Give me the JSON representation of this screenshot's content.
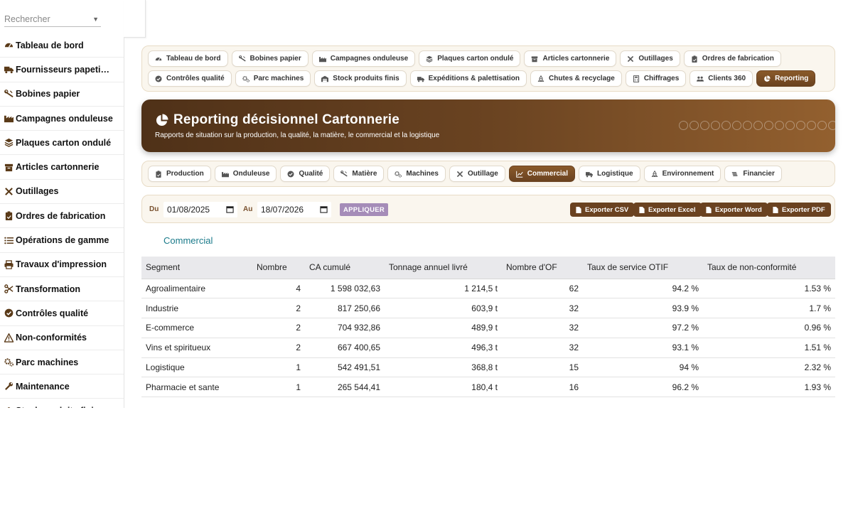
{
  "search": {
    "placeholder": "Rechercher"
  },
  "sidebar": {
    "items": [
      {
        "label": "Tableau de bord",
        "icon": "gauge-icon"
      },
      {
        "label": "Fournisseurs papeti…",
        "icon": "truck-icon"
      },
      {
        "label": "Bobines papier",
        "icon": "paper-roll-icon"
      },
      {
        "label": "Campagnes onduleuse",
        "icon": "industry-icon"
      },
      {
        "label": "Plaques carton ondulé",
        "icon": "layers-icon"
      },
      {
        "label": "Articles cartonnerie",
        "icon": "box-icon"
      },
      {
        "label": "Outillages",
        "icon": "tools-icon"
      },
      {
        "label": "Ordres de fabrication",
        "icon": "clipboard-icon"
      },
      {
        "label": "Opérations de gamme",
        "icon": "list-icon"
      },
      {
        "label": "Travaux d'impression",
        "icon": "printer-icon"
      },
      {
        "label": "Transformation",
        "icon": "scissors-icon"
      },
      {
        "label": "Contrôles qualité",
        "icon": "check-circle-icon"
      },
      {
        "label": "Non-conformités",
        "icon": "warning-icon"
      },
      {
        "label": "Parc machines",
        "icon": "gears-icon"
      },
      {
        "label": "Maintenance",
        "icon": "wrench-icon"
      },
      {
        "label": "Stock produits finis",
        "icon": "warehouse-icon"
      }
    ]
  },
  "topnav": {
    "items": [
      {
        "label": "Tableau de bord",
        "icon": "gauge-icon",
        "active": false
      },
      {
        "label": "Bobines papier",
        "icon": "paper-roll-icon",
        "active": false
      },
      {
        "label": "Campagnes onduleuse",
        "icon": "industry-icon",
        "active": false
      },
      {
        "label": "Plaques carton ondulé",
        "icon": "layers-icon",
        "active": false
      },
      {
        "label": "Articles cartonnerie",
        "icon": "box-icon",
        "active": false
      },
      {
        "label": "Outillages",
        "icon": "tools-icon",
        "active": false
      },
      {
        "label": "Ordres de fabrication",
        "icon": "clipboard-icon",
        "active": false
      },
      {
        "label": "Contrôles qualité",
        "icon": "check-circle-icon",
        "active": false
      },
      {
        "label": "Parc machines",
        "icon": "gears-icon",
        "active": false
      },
      {
        "label": "Stock produits finis",
        "icon": "warehouse-icon",
        "active": false
      },
      {
        "label": "Expéditions & palettisation",
        "icon": "truck-icon",
        "active": false
      },
      {
        "label": "Chutes & recyclage",
        "icon": "recycle-icon",
        "active": false
      },
      {
        "label": "Chiffrages",
        "icon": "calculator-icon",
        "active": false
      },
      {
        "label": "Clients 360",
        "icon": "users-icon",
        "active": false
      },
      {
        "label": "Reporting",
        "icon": "pie-chart-icon",
        "active": true
      }
    ]
  },
  "banner": {
    "title": "Reporting décisionnel Cartonnerie",
    "subtitle": "Rapports de situation sur la production, la qualité, la matière, le commercial et la logistique",
    "icon": "pie-chart-icon"
  },
  "subnav": {
    "items": [
      {
        "label": "Production",
        "icon": "clipboard-icon",
        "active": false
      },
      {
        "label": "Onduleuse",
        "icon": "industry-icon",
        "active": false
      },
      {
        "label": "Qualité",
        "icon": "check-circle-icon",
        "active": false
      },
      {
        "label": "Matière",
        "icon": "paper-roll-icon",
        "active": false
      },
      {
        "label": "Machines",
        "icon": "gears-icon",
        "active": false
      },
      {
        "label": "Outillage",
        "icon": "tools-icon",
        "active": false
      },
      {
        "label": "Commercial",
        "icon": "line-chart-icon",
        "active": true
      },
      {
        "label": "Logistique",
        "icon": "truck-icon",
        "active": false
      },
      {
        "label": "Environnement",
        "icon": "recycle-icon",
        "active": false
      },
      {
        "label": "Financier",
        "icon": "coins-icon",
        "active": false
      }
    ]
  },
  "filter": {
    "from_label": "Du",
    "from_value": "01/08/2025",
    "to_label": "Au",
    "to_value": "18/07/2026",
    "apply_label": "APPLIQUER",
    "export_csv": "Exporter CSV",
    "export_excel": "Exporter Excel",
    "export_word": "Exporter Word",
    "export_pdf": "Exporter PDF"
  },
  "section": {
    "title": "Commercial"
  },
  "table": {
    "headers": [
      "Segment",
      "Nombre",
      "CA cumulé",
      "Tonnage annuel livré",
      "Nombre d'OF",
      "Taux de service OTIF",
      "Taux de non-conformité"
    ],
    "rows": [
      [
        "Agroalimentaire",
        "4",
        "1 598 032,63",
        "1 214,5 t",
        "62",
        "94.2 %",
        "1.53 %"
      ],
      [
        "Industrie",
        "2",
        "817 250,66",
        "603,9 t",
        "32",
        "93.9 %",
        "1.7 %"
      ],
      [
        "E-commerce",
        "2",
        "704 932,86",
        "489,9 t",
        "32",
        "97.2 %",
        "0.96 %"
      ],
      [
        "Vins et spiritueux",
        "2",
        "667 400,65",
        "496,3 t",
        "32",
        "93.1 %",
        "1.51 %"
      ],
      [
        "Logistique",
        "1",
        "542 491,51",
        "368,8 t",
        "15",
        "94 %",
        "2.32 %"
      ],
      [
        "Pharmacie et sante",
        "1",
        "265 544,41",
        "180,4 t",
        "16",
        "96.2 %",
        "1.93 %"
      ]
    ]
  },
  "colors": {
    "accent_brown": "#6a4220",
    "banner_start": "#4f3118",
    "banner_end": "#93602f",
    "apply_purple": "#a58cb8",
    "section_teal": "#1a7a8a"
  }
}
